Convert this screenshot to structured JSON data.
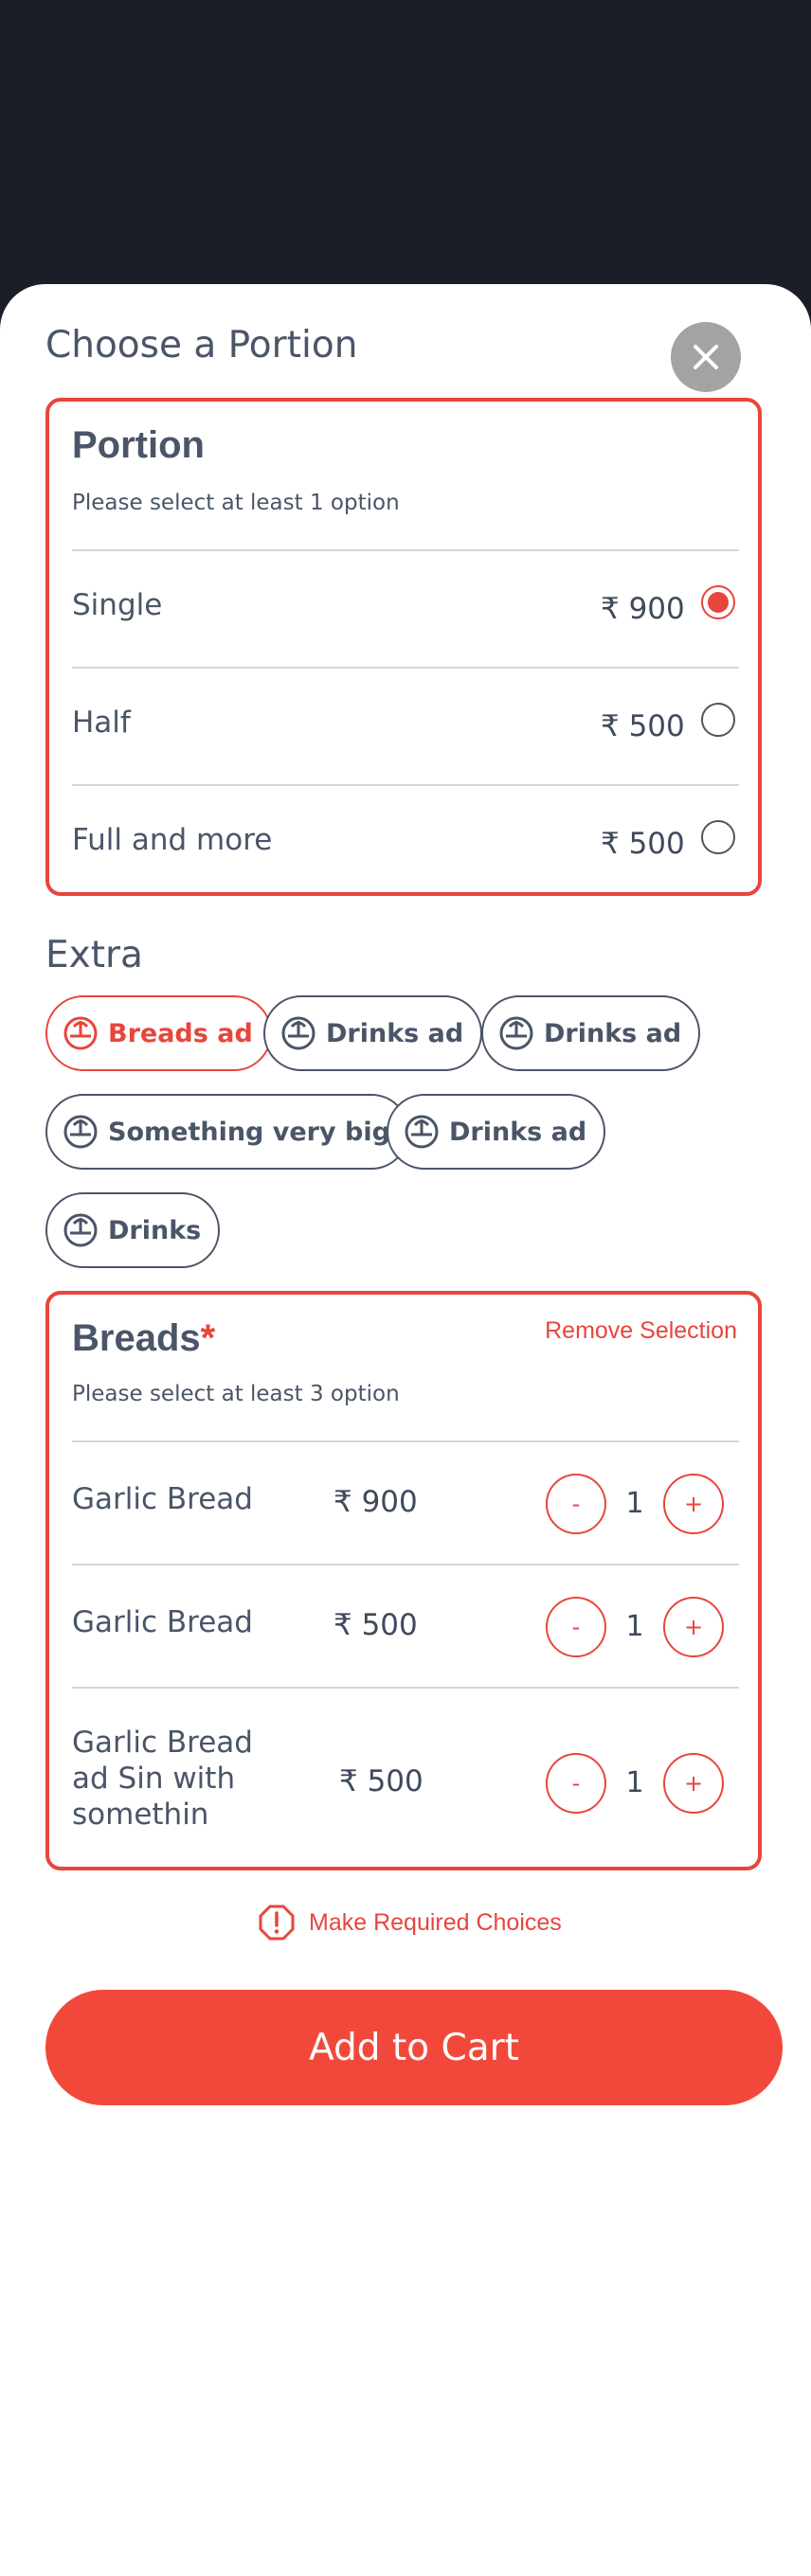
{
  "modal": {
    "title": "Choose a Portion",
    "close_icon": "close-icon",
    "accent_color": "#e8453c",
    "cta_color": "#f2483b"
  },
  "portion": {
    "title": "Portion",
    "subtitle": "Please select at least 1 option",
    "options": [
      {
        "label": "Single",
        "price": "₹ 900",
        "selected": true
      },
      {
        "label": "Half",
        "price": "₹ 500",
        "selected": false
      },
      {
        "label": "Full and more",
        "price": "₹ 500",
        "selected": false
      }
    ]
  },
  "extra": {
    "title": "Extra",
    "chip_icon": "food-dome-icon",
    "chips": [
      {
        "label": "Breads ad",
        "selected": true
      },
      {
        "label": "Drinks ad",
        "selected": false
      },
      {
        "label": "Drinks ad",
        "selected": false
      },
      {
        "label": "Something very big",
        "selected": false
      },
      {
        "label": "Drinks ad",
        "selected": false
      },
      {
        "label": "Drinks",
        "selected": false
      }
    ]
  },
  "breads": {
    "title": "Breads",
    "required_mark": "*",
    "remove_label": "Remove Selection",
    "subtitle": "Please select at least 3 option",
    "items": [
      {
        "label": "Garlic Bread",
        "price": "₹ 900",
        "qty": "1",
        "minus": "-",
        "plus": "+"
      },
      {
        "label": "Garlic Bread",
        "price": "₹ 500",
        "qty": "1",
        "minus": "-",
        "plus": "+"
      },
      {
        "label": "Garlic Bread ad Sin with somethin",
        "price": "₹ 500",
        "qty": "1",
        "minus": "-",
        "plus": "+"
      }
    ]
  },
  "warning": {
    "icon": "alert-octagon-icon",
    "text": "Make Required Choices"
  },
  "cta": {
    "label": "Add to Cart"
  }
}
